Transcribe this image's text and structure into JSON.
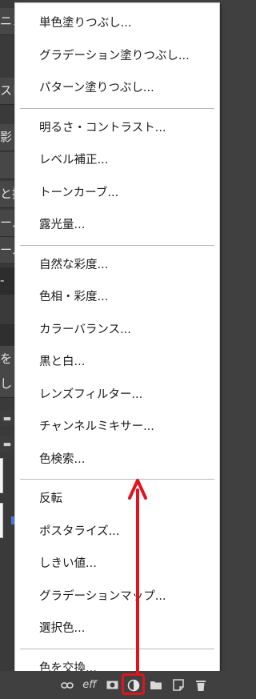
{
  "background": {
    "left_cells": [
      "ニン",
      "スビ",
      "影",
      "",
      "と描",
      "ール",
      "ール",
      "-",
      "",
      "を",
      "し"
    ]
  },
  "menu": {
    "group1": [
      {
        "label": "単色塗りつぶし..."
      },
      {
        "label": "グラデーション塗りつぶし..."
      },
      {
        "label": "パターン塗りつぶし..."
      }
    ],
    "group2": [
      {
        "label": "明るさ・コントラスト..."
      },
      {
        "label": "レベル補正..."
      },
      {
        "label": "トーンカーブ..."
      },
      {
        "label": "露光量..."
      }
    ],
    "group3": [
      {
        "label": "自然な彩度..."
      },
      {
        "label": "色相・彩度..."
      },
      {
        "label": "カラーバランス..."
      },
      {
        "label": "黒と白..."
      },
      {
        "label": "レンズフィルター..."
      },
      {
        "label": "チャンネルミキサー..."
      },
      {
        "label": "色検索..."
      }
    ],
    "group4": [
      {
        "label": "反転"
      },
      {
        "label": "ポスタライズ..."
      },
      {
        "label": "しきい値..."
      },
      {
        "label": "グラデーションマップ..."
      },
      {
        "label": "選択色..."
      }
    ],
    "group5": [
      {
        "label": "色を交換..."
      }
    ]
  },
  "toolbar": {
    "fx_label": "eff",
    "icons": [
      "link-icon",
      "effects-icon",
      "mask-icon",
      "adjustment-layer-icon",
      "folder-icon",
      "new-layer-icon",
      "trash-icon"
    ]
  },
  "colors": {
    "menu_background": "#ffffff",
    "panel_background": "#404040",
    "annotation_red": "#e0141c"
  }
}
